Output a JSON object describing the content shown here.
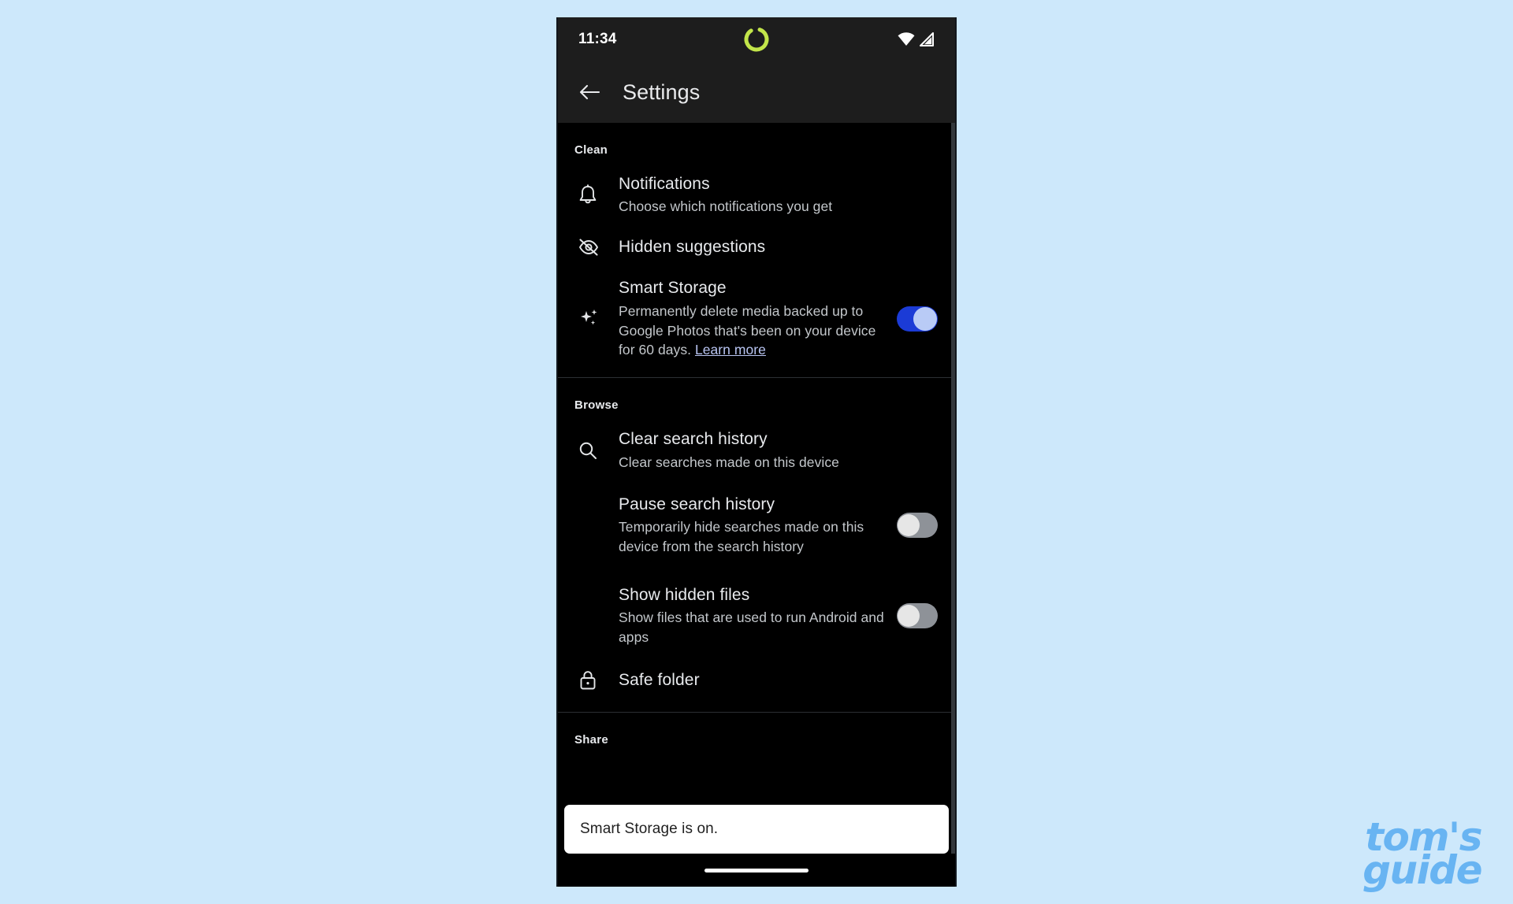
{
  "background_color": "#cde8fb",
  "status_bar": {
    "time": "11:34",
    "spinner_color": "#c2e54a",
    "icons": [
      "wifi-icon",
      "cell-signal-icon"
    ]
  },
  "app_bar": {
    "back_label": "back-arrow",
    "title": "Settings"
  },
  "sections": [
    {
      "header": "Clean",
      "rows": [
        {
          "icon": "bell-icon",
          "title": "Notifications",
          "subtitle": "Choose which notifications you get",
          "toggle": null
        },
        {
          "icon": "eye-off-icon",
          "title": "Hidden suggestions",
          "subtitle": "",
          "toggle": null
        },
        {
          "icon": "sparkle-icon",
          "title": "Smart Storage",
          "subtitle": "Permanently delete media backed up to Google Photos that's been on your device for 60 days. ",
          "link_text": "Learn more",
          "toggle": "on"
        }
      ]
    },
    {
      "header": "Browse",
      "rows": [
        {
          "icon": "search-icon",
          "title": "Clear search history",
          "subtitle": "Clear searches made on this device",
          "toggle": null
        },
        {
          "icon": "",
          "title": "Pause search history",
          "subtitle": "Temporarily hide searches made on this device from the search history",
          "toggle": "off"
        },
        {
          "icon": "",
          "title": "Show hidden files",
          "subtitle": "Show files that are used to run Android and apps",
          "toggle": "off"
        },
        {
          "icon": "lock-icon",
          "title": "Safe folder",
          "subtitle": "",
          "toggle": null
        }
      ]
    },
    {
      "header": "Share",
      "rows": []
    }
  ],
  "snackbar": {
    "message": "Smart Storage is on."
  },
  "watermark": {
    "line1": "tom's",
    "line2": "guide",
    "color": "#68b4f2"
  },
  "toggle_colors": {
    "on_track": "#1b3bd6",
    "on_knob": "#b9cbf6",
    "off_track": "#8e9298",
    "off_knob": "#e6e6e6"
  }
}
